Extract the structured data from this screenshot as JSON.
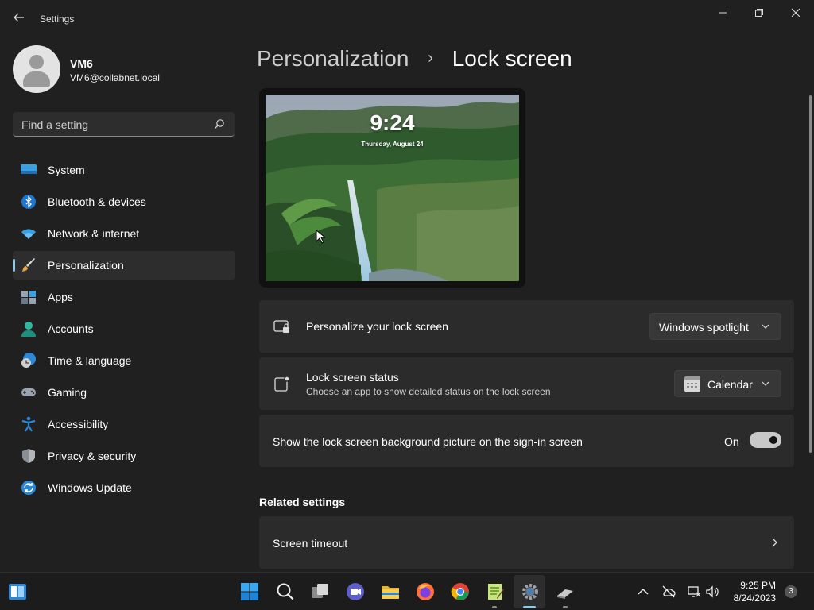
{
  "app": {
    "title": "Settings"
  },
  "window_controls": {
    "minimize": "─",
    "maximize": "❐",
    "close": "✕"
  },
  "user": {
    "name": "VM6",
    "email": "VM6@collabnet.local"
  },
  "search": {
    "placeholder": "Find a setting"
  },
  "sidebar": {
    "items": [
      {
        "label": "System",
        "icon": "system-icon"
      },
      {
        "label": "Bluetooth & devices",
        "icon": "bluetooth-icon"
      },
      {
        "label": "Network & internet",
        "icon": "wifi-icon"
      },
      {
        "label": "Personalization",
        "icon": "brush-icon",
        "active": true
      },
      {
        "label": "Apps",
        "icon": "apps-icon"
      },
      {
        "label": "Accounts",
        "icon": "accounts-icon"
      },
      {
        "label": "Time & language",
        "icon": "clock-globe-icon"
      },
      {
        "label": "Gaming",
        "icon": "gamepad-icon"
      },
      {
        "label": "Accessibility",
        "icon": "accessibility-icon"
      },
      {
        "label": "Privacy & security",
        "icon": "shield-icon"
      },
      {
        "label": "Windows Update",
        "icon": "update-icon"
      }
    ]
  },
  "breadcrumb": {
    "parent": "Personalization",
    "separator": "›",
    "current": "Lock screen"
  },
  "preview": {
    "time": "9:24",
    "date": "Thursday, August 24"
  },
  "settings": {
    "personalize": {
      "title": "Personalize your lock screen",
      "value": "Windows spotlight"
    },
    "status": {
      "title": "Lock screen status",
      "subtitle": "Choose an app to show detailed status on the lock screen",
      "value": "Calendar"
    },
    "signin_background": {
      "title": "Show the lock screen background picture on the sign-in screen",
      "state": "On",
      "on": true
    }
  },
  "related": {
    "heading": "Related settings",
    "items": [
      {
        "label": "Screen timeout"
      }
    ]
  },
  "taskbar": {
    "apps": [
      "start-icon",
      "search-icon",
      "task-view-icon",
      "teams-chat-icon",
      "file-explorer-icon",
      "firefox-icon",
      "chrome-icon",
      "notepad-plus-icon",
      "settings-icon",
      "eraser-app-icon"
    ],
    "time": "9:25 PM",
    "date": "8/24/2023",
    "notification_count": "3"
  },
  "colors": {
    "accent": "#8ec9e8",
    "background": "#202020",
    "card": "#2b2b2b"
  }
}
